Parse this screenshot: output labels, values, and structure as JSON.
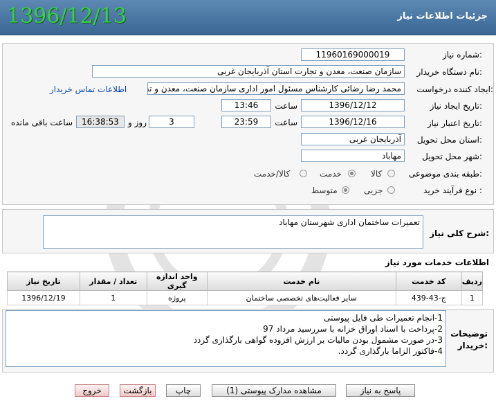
{
  "header": {
    "title": "جزئیات اطلاعات نیاز",
    "date": "1396/12/13"
  },
  "form": {
    "need_number_label": "شماره نیاز:",
    "need_number": "1196016900001‎9",
    "buyer_org_label": "نام دستگاه خریدار:",
    "buyer_org": "سازمان صنعت، معدن و تجارت استان آذربایجان غربی",
    "creator_label": "ایجاد کننده درخواست:",
    "creator": "محمد رضا رضائی کارشناس مسئول امور اداری سازمان صنعت، معدن و تجارت اس",
    "contact_link": "اطلاعات تماس خریدار",
    "created_label": "تاریخ ایجاد نیاز:",
    "created_date": "1396/12/12",
    "time_word": "ساعت",
    "created_time": "13:46",
    "valid_label": "تاریخ اعتبار نیاز:",
    "valid_date": "1396/12/16",
    "valid_time": "23:59",
    "days": "3",
    "days_word": "روز و",
    "remaining": "16:38:53",
    "remaining_word": "ساعت باقی مانده",
    "province_label": "استان محل تحویل:",
    "province": "آذربایجان غربی",
    "city_label": "شهر محل تحویل:",
    "city": "مهاباد",
    "category_label": "طبقه بندی موضوعی:",
    "category_options": [
      "کالا",
      "خدمت",
      "کالا/خدمت"
    ],
    "category_selected": "خدمت",
    "process_label": "نوع فرآیند خرید :",
    "process_options": [
      "جزیی",
      "متوسط"
    ],
    "process_selected": "متوسط"
  },
  "summary": {
    "label": "شرح کلی نیاز:",
    "text": "تعمیرات ساختمان اداری شهرستان مهاباد"
  },
  "services": {
    "section_title": "اطلاعات خدمات مورد نیاز",
    "headers": [
      "ردیف",
      "کد خدمت",
      "نام خدمت",
      "واحد اندازه گیری",
      "تعداد / مقدار",
      "تاریخ نیاز"
    ],
    "rows": [
      [
        "1",
        "ج-43-439",
        "سایر فعالیت‌های تخصصی ساختمان",
        "پروژه",
        "1",
        "1396/12/19"
      ]
    ]
  },
  "buyer_notes": {
    "label_line1": "توضیحات",
    "label_line2": "خریدار:",
    "lines": [
      "1-انجام تعمیرات طی فایل پیوستی",
      "2-پرداخت با اسناد اوراق خزانه با سررسید مرداد 97",
      "3-در صورت مشمول بودن مالیات بر ارزش افزوده گواهی بارگذاری گردد",
      "4-فاکتور الزاما بارگذاری گردد."
    ]
  },
  "buttons": {
    "reply": "پاسخ به نیاز",
    "attachments": "مشاهده مدارک پیوستی (1)",
    "print": "چاپ",
    "back": "بازگشت",
    "exit": "خروج"
  },
  "colors": {
    "header": "#3f6d99",
    "date": "#36d04a",
    "link": "#0645ad"
  }
}
